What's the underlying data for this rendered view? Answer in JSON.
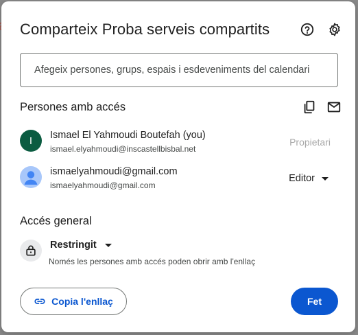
{
  "dialog": {
    "title": "Comparteix Proba serveis compartits",
    "help_icon": "help-circle-icon",
    "settings_icon": "gear-icon"
  },
  "add_people": {
    "placeholder": "Afegeix persones, grups, espais i esdeveniments del calendari"
  },
  "people_section": {
    "title": "Persones amb accés",
    "copy_icon": "copy-icon",
    "email_icon": "mail-icon",
    "people": [
      {
        "avatar_letter": "I",
        "name": "Ismael El Yahmoudi Boutefah (you)",
        "email": "ismael.elyahmoudi@inscastellbisbal.net",
        "role": "Propietari"
      },
      {
        "avatar_icon": "person-avatar-icon",
        "name": "ismaelyahmoudi@gmail.com",
        "email": "ismaelyahmoudi@gmail.com",
        "role": "Editor"
      }
    ]
  },
  "general_access": {
    "title": "Accés general",
    "lock_icon": "lock-icon",
    "setting": "Restringit",
    "description": "Només les persones amb accés poden obrir amb l'enllaç"
  },
  "footer": {
    "copy_link_label": "Copia l'enllaç",
    "link_icon": "link-icon",
    "done_label": "Fet"
  },
  "colors": {
    "primary": "#0b57d0",
    "avatar_green": "#0b5c41",
    "avatar_photo_bg": "#a8c7fa",
    "owner_role_gray": "#a8a8a8"
  }
}
